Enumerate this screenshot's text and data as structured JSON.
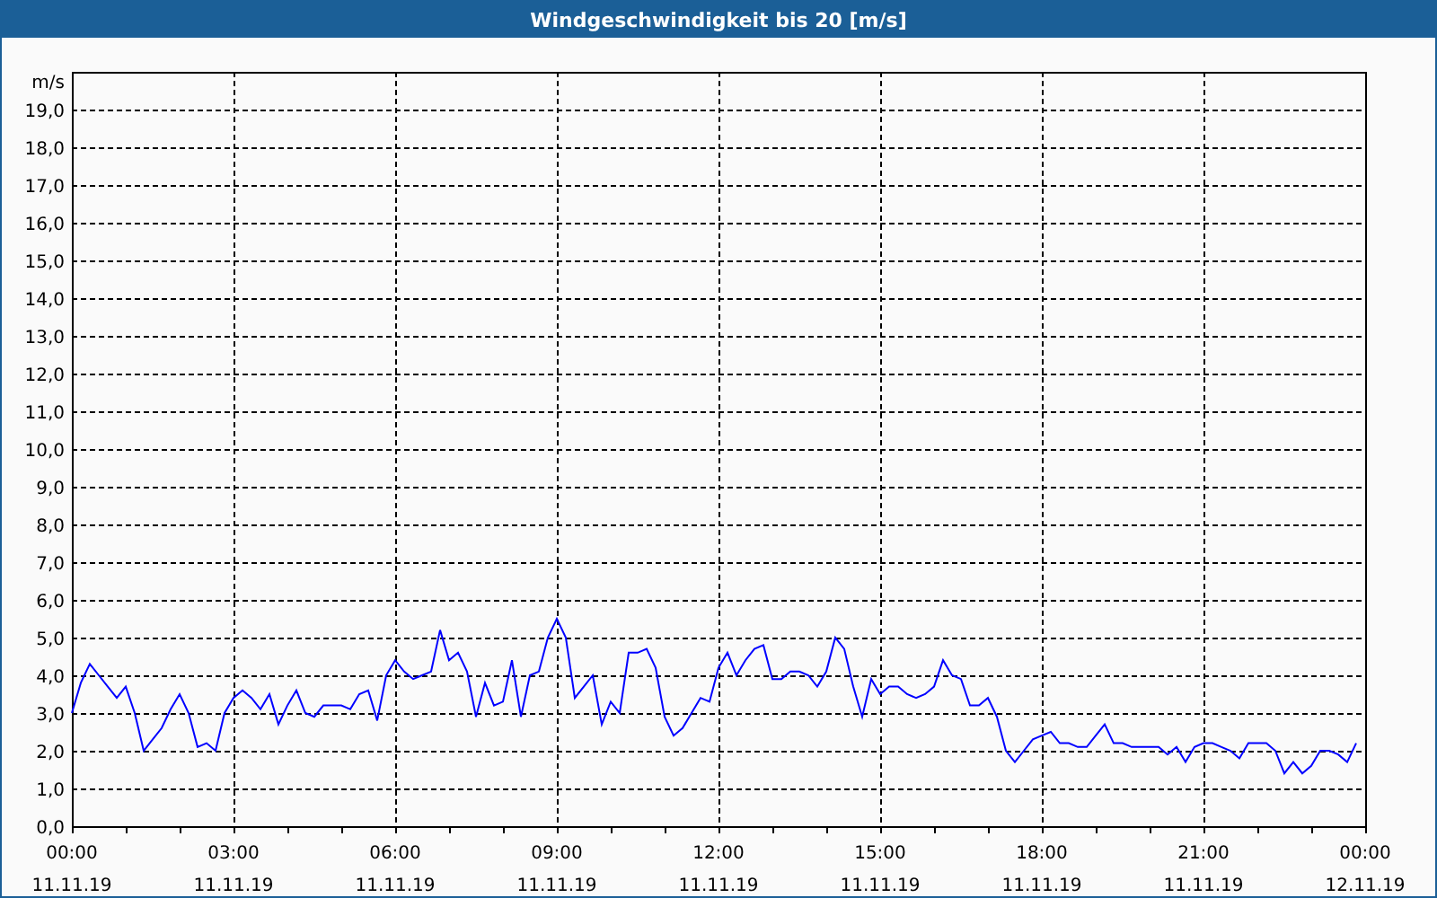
{
  "window": {
    "title": "Windgeschwindigkeit bis 20 [m/s]"
  },
  "chart": {
    "chart_data": {
      "type": "line",
      "grid": true,
      "ylabel": "m/s",
      "ylim": [
        0,
        20
      ],
      "yticks": [
        {
          "value": 0,
          "label": "0,0"
        },
        {
          "value": 1,
          "label": "1,0"
        },
        {
          "value": 2,
          "label": "2,0"
        },
        {
          "value": 3,
          "label": "3,0"
        },
        {
          "value": 4,
          "label": "4,0"
        },
        {
          "value": 5,
          "label": "5,0"
        },
        {
          "value": 6,
          "label": "6,0"
        },
        {
          "value": 7,
          "label": "7,0"
        },
        {
          "value": 8,
          "label": "8,0"
        },
        {
          "value": 9,
          "label": "9,0"
        },
        {
          "value": 10,
          "label": "10,0"
        },
        {
          "value": 11,
          "label": "11,0"
        },
        {
          "value": 12,
          "label": "12,0"
        },
        {
          "value": 13,
          "label": "13,0"
        },
        {
          "value": 14,
          "label": "14,0"
        },
        {
          "value": 15,
          "label": "15,0"
        },
        {
          "value": 16,
          "label": "16,0"
        },
        {
          "value": 17,
          "label": "17,0"
        },
        {
          "value": 18,
          "label": "18,0"
        },
        {
          "value": 19,
          "label": "19,0"
        }
      ],
      "categories": [
        "00:00\n11.11.19",
        null,
        null,
        null,
        null,
        null,
        null,
        null,
        null,
        null,
        null,
        null,
        null,
        null,
        null,
        null,
        null,
        null,
        "03:00\n11.11.19",
        null,
        null,
        null,
        null,
        null,
        null,
        null,
        null,
        null,
        null,
        null,
        null,
        null,
        null,
        null,
        null,
        null,
        "06:00\n11.11.19",
        null,
        null,
        null,
        null,
        null,
        null,
        null,
        null,
        null,
        null,
        null,
        null,
        null,
        null,
        null,
        null,
        null,
        "09:00\n11.11.19",
        null,
        null,
        null,
        null,
        null,
        null,
        null,
        null,
        null,
        null,
        null,
        null,
        null,
        null,
        null,
        null,
        null,
        "12:00\n11.11.19",
        null,
        null,
        null,
        null,
        null,
        null,
        null,
        null,
        null,
        null,
        null,
        null,
        null,
        null,
        null,
        null,
        null,
        "15:00\n11.11.19",
        null,
        null,
        null,
        null,
        null,
        null,
        null,
        null,
        null,
        null,
        null,
        null,
        null,
        null,
        null,
        null,
        null,
        "18:00\n11.11.19",
        null,
        null,
        null,
        null,
        null,
        null,
        null,
        null,
        null,
        null,
        null,
        null,
        null,
        null,
        null,
        null,
        null,
        "21:00\n11.11.19",
        null,
        null,
        null,
        null,
        null,
        null,
        null,
        null,
        null,
        null,
        null,
        null,
        null,
        null,
        null,
        null,
        null,
        "00:00\n12.11.19"
      ],
      "series": [
        {
          "color": "#0000ff",
          "values": [
            3.0,
            3.8,
            4.3,
            4.0,
            3.7,
            3.4,
            3.7,
            3.0,
            2.0,
            2.3,
            2.6,
            3.1,
            3.5,
            3.0,
            2.1,
            2.2,
            2.0,
            3.0,
            3.4,
            3.6,
            3.4,
            3.1,
            3.5,
            2.7,
            3.2,
            3.6,
            3.0,
            2.9,
            3.2,
            3.2,
            3.2,
            3.1,
            3.5,
            3.6,
            2.8,
            4.0,
            4.4,
            4.1,
            3.9,
            4.0,
            4.1,
            5.2,
            4.4,
            4.6,
            4.1,
            2.9,
            3.8,
            3.2,
            3.3,
            4.4,
            2.9,
            4.0,
            4.1,
            5.0,
            5.5,
            5.0,
            3.4,
            3.7,
            4.0,
            2.7,
            3.3,
            3.0,
            4.6,
            4.6,
            4.7,
            4.2,
            2.9,
            2.4,
            2.6,
            3.0,
            3.4,
            3.3,
            4.2,
            4.6,
            4.0,
            4.4,
            4.7,
            4.8,
            3.9,
            3.9,
            4.1,
            4.1,
            4.0,
            3.7,
            4.1,
            5.0,
            4.7,
            3.7,
            2.9,
            3.9,
            3.5,
            3.7,
            3.7,
            3.5,
            3.4,
            3.5,
            3.7,
            4.4,
            4.0,
            3.9,
            3.2,
            3.2,
            3.4,
            2.9,
            2.0,
            1.7,
            2.0,
            2.3,
            2.4,
            2.5,
            2.2,
            2.2,
            2.1,
            2.1,
            2.4,
            2.7,
            2.2,
            2.2,
            2.1,
            2.1,
            2.1,
            2.1,
            1.9,
            2.1,
            1.7,
            2.1,
            2.2,
            2.2,
            2.1,
            2.0,
            1.8,
            2.2,
            2.2,
            2.2,
            2.0,
            1.4,
            1.7,
            1.4,
            1.6,
            2.0,
            2.0,
            1.9,
            1.7,
            2.2,
            null
          ]
        }
      ]
    }
  }
}
